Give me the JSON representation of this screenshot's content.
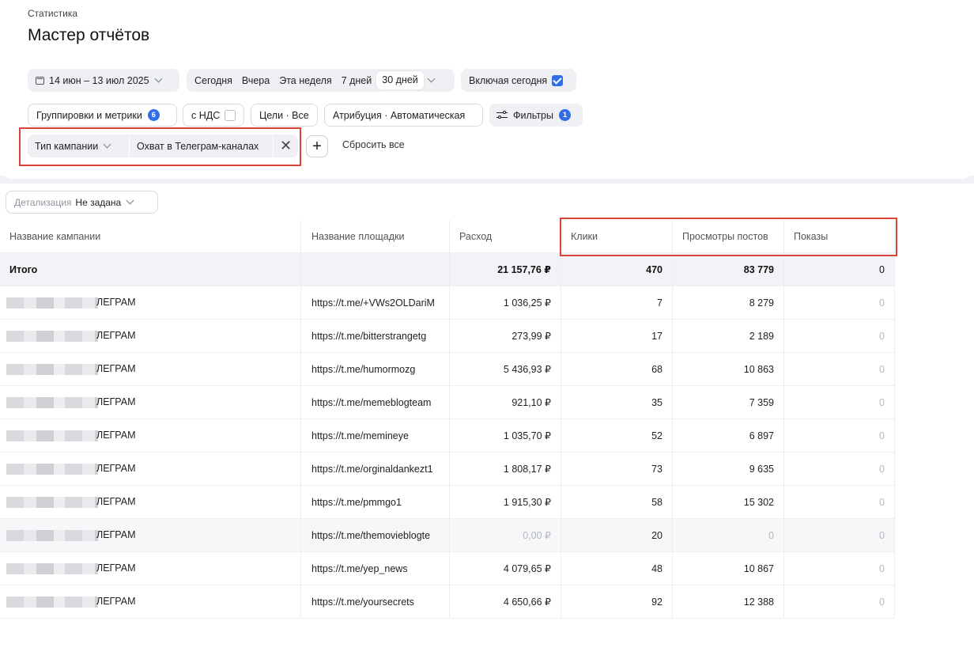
{
  "header": {
    "breadcrumb": "Статистика",
    "title": "Мастер отчётов"
  },
  "period": {
    "range": "14 июн – 13 июл 2025",
    "presets": [
      "Сегодня",
      "Вчера",
      "Эта неделя",
      "7 дней",
      "30 дней"
    ],
    "selected_preset": "30 дней",
    "include_today_label": "Включая сегодня",
    "include_today_checked": true
  },
  "settings": {
    "groupings_label": "Группировки и метрики",
    "groupings_count": "6",
    "vat_label": "с НДС",
    "vat_checked": false,
    "goals_label": "Цели · Все",
    "attribution_label": "Атрибуция · Автоматическая",
    "filters_label": "Фильтры",
    "filters_count": "1"
  },
  "filter_chip": {
    "field": "Тип кампании",
    "value": "Охват в Телеграм-каналах",
    "reset_label": "Сбросить все"
  },
  "detail": {
    "label": "Детализация",
    "value": "Не задана"
  },
  "table": {
    "columns": [
      "Название кампании",
      "Название площадки",
      "Расход",
      "Клики",
      "Просмотры постов",
      "Показы"
    ],
    "total": {
      "label": "Итого",
      "spend": "21 157,76 ₽",
      "clicks": "470",
      "views": "83 779",
      "impressions": "0"
    },
    "rows": [
      {
        "campaign": "ЛЕГРАМ",
        "site": "https://t.me/+VWs2OLDariM",
        "spend": "1 036,25 ₽",
        "clicks": "7",
        "views": "8 279",
        "impressions": "0"
      },
      {
        "campaign": "ЛЕГРАМ",
        "site": "https://t.me/bitterstrangetg",
        "spend": "273,99 ₽",
        "clicks": "17",
        "views": "2 189",
        "impressions": "0"
      },
      {
        "campaign": "ЛЕГРАМ",
        "site": "https://t.me/humormozg",
        "spend": "5 436,93 ₽",
        "clicks": "68",
        "views": "10 863",
        "impressions": "0"
      },
      {
        "campaign": "ЛЕГРАМ",
        "site": "https://t.me/memeblogteam",
        "spend": "921,10 ₽",
        "clicks": "35",
        "views": "7 359",
        "impressions": "0"
      },
      {
        "campaign": "ЛЕГРАМ",
        "site": "https://t.me/memineye",
        "spend": "1 035,70 ₽",
        "clicks": "52",
        "views": "6 897",
        "impressions": "0"
      },
      {
        "campaign": "ЛЕГРАМ",
        "site": "https://t.me/orginaldankezt1",
        "spend": "1 808,17 ₽",
        "clicks": "73",
        "views": "9 635",
        "impressions": "0"
      },
      {
        "campaign": "ЛЕГРАМ",
        "site": "https://t.me/pmmgo1",
        "spend": "1 915,30 ₽",
        "clicks": "58",
        "views": "15 302",
        "impressions": "0"
      },
      {
        "campaign": "ЛЕГРАМ",
        "site": "https://t.me/themovieblogte",
        "spend": "0,00 ₽",
        "clicks": "20",
        "views": "0",
        "impressions": "0"
      },
      {
        "campaign": "ЛЕГРАМ",
        "site": "https://t.me/yep_news",
        "spend": "4 079,65 ₽",
        "clicks": "48",
        "views": "10 867",
        "impressions": "0"
      },
      {
        "campaign": "ЛЕГРАМ",
        "site": "https://t.me/yoursecrets",
        "spend": "4 650,66 ₽",
        "clicks": "92",
        "views": "12 388",
        "impressions": "0"
      }
    ]
  }
}
